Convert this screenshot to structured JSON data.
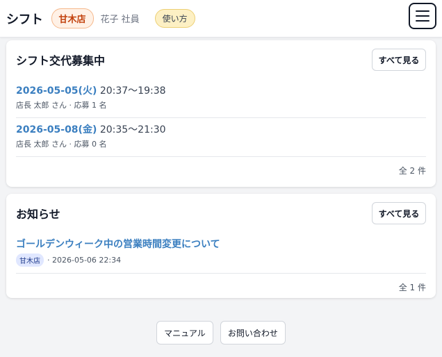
{
  "header": {
    "brand": "シフト",
    "store": "甘木店",
    "user": "花子 社員",
    "help": "使い方"
  },
  "swap": {
    "title": "シフト交代募集中",
    "see_all": "すべて見る",
    "items": [
      {
        "date": "2026-05-05(火)",
        "time": "20:37〜19:38",
        "meta": "店長 太郎 さん · 応募 1 名"
      },
      {
        "date": "2026-05-08(金)",
        "time": "20:35〜21:30",
        "meta": "店長 太郎 さん · 応募 0 名"
      }
    ],
    "count": "全 2 件"
  },
  "news": {
    "title": "お知らせ",
    "see_all": "すべて見る",
    "items": [
      {
        "title": "ゴールデンウィーク中の営業時間変更について",
        "store": "甘木店",
        "meta": "· 2026-05-06 22:34"
      }
    ],
    "count": "全 1 件"
  },
  "footer": {
    "manual": "マニュアル",
    "contact": "お問い合わせ"
  }
}
